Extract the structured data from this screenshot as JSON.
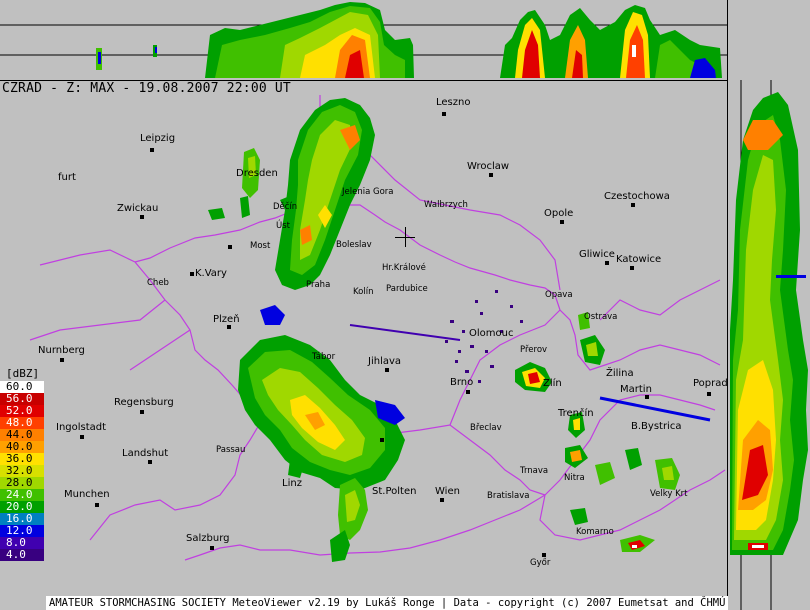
{
  "header": {
    "title": "CZRAD - Z: MAX - 19.08.2007 22:00 UT"
  },
  "legend": {
    "unit": "[dBZ]",
    "levels": [
      {
        "label": "60.0",
        "color": "#ffffff"
      },
      {
        "label": "56.0",
        "color": "#c80000"
      },
      {
        "label": "52.0",
        "color": "#e00000"
      },
      {
        "label": "48.0",
        "color": "#ff4000"
      },
      {
        "label": "44.0",
        "color": "#ff8000"
      },
      {
        "label": "40.0",
        "color": "#ffa000"
      },
      {
        "label": "36.0",
        "color": "#ffe000"
      },
      {
        "label": "32.0",
        "color": "#d8e000"
      },
      {
        "label": "28.0",
        "color": "#a0d800"
      },
      {
        "label": "24.0",
        "color": "#40c000"
      },
      {
        "label": "20.0",
        "color": "#00a000"
      },
      {
        "label": "16.0",
        "color": "#0080c0"
      },
      {
        "label": "12.0",
        "color": "#0000e0"
      },
      {
        "label": "8.0",
        "color": "#4000b0"
      },
      {
        "label": "4.0",
        "color": "#380080"
      }
    ]
  },
  "cities": [
    {
      "id": "leszno",
      "label": "Leszno"
    },
    {
      "id": "leipzig",
      "label": "Leipzig"
    },
    {
      "id": "furt",
      "label": "furt"
    },
    {
      "id": "dresden",
      "label": "Dresden"
    },
    {
      "id": "wroclaw",
      "label": "Wroclaw"
    },
    {
      "id": "czestochowa",
      "label": "Czestochowa"
    },
    {
      "id": "jelenia",
      "label": "Jelenia Gora"
    },
    {
      "id": "walbrzych",
      "label": "Walbrzych"
    },
    {
      "id": "zwickau",
      "label": "Zwickau"
    },
    {
      "id": "decin",
      "label": "Děčín"
    },
    {
      "id": "opole",
      "label": "Opole"
    },
    {
      "id": "most",
      "label": "Most"
    },
    {
      "id": "usti",
      "label": "Úst"
    },
    {
      "id": "boleslav",
      "label": "Boleslav"
    },
    {
      "id": "gliwice",
      "label": "Gliwice"
    },
    {
      "id": "katowice",
      "label": "Katowice"
    },
    {
      "id": "kvary",
      "label": "K.Vary"
    },
    {
      "id": "hkralove",
      "label": "Hr.Králové"
    },
    {
      "id": "cheb",
      "label": "Cheb"
    },
    {
      "id": "praha",
      "label": "Praha"
    },
    {
      "id": "kolin",
      "label": "Kolín"
    },
    {
      "id": "pardubice",
      "label": "Pardubice"
    },
    {
      "id": "opava",
      "label": "Opava"
    },
    {
      "id": "plzen",
      "label": "Plzeň"
    },
    {
      "id": "olomouc",
      "label": "Olomouc"
    },
    {
      "id": "ostrava",
      "label": "Ostrava"
    },
    {
      "id": "nurnberg",
      "label": "Nurnberg"
    },
    {
      "id": "tabor",
      "label": "Tábor"
    },
    {
      "id": "jihlava",
      "label": "Jihlava"
    },
    {
      "id": "prerov",
      "label": "Přerov"
    },
    {
      "id": "zilina",
      "label": "Žilina"
    },
    {
      "id": "brno",
      "label": "Brno"
    },
    {
      "id": "zlin",
      "label": "Zlín"
    },
    {
      "id": "martin",
      "label": "Martin"
    },
    {
      "id": "poprad",
      "label": "Poprad"
    },
    {
      "id": "regensburg",
      "label": "Regensburg"
    },
    {
      "id": "trencin",
      "label": "Trenčín"
    },
    {
      "id": "ingolstadt",
      "label": "Ingolstadt"
    },
    {
      "id": "breclav",
      "label": "Břeclav"
    },
    {
      "id": "bbystrica",
      "label": "B.Bystrica"
    },
    {
      "id": "passau",
      "label": "Passau"
    },
    {
      "id": "landshut",
      "label": "Landshut"
    },
    {
      "id": "trnava",
      "label": "Trnava"
    },
    {
      "id": "nitra",
      "label": "Nitra"
    },
    {
      "id": "linz",
      "label": "Linz"
    },
    {
      "id": "stpolten",
      "label": "St.Polten"
    },
    {
      "id": "wien",
      "label": "Wien"
    },
    {
      "id": "bratislava",
      "label": "Bratislava"
    },
    {
      "id": "munchen",
      "label": "Munchen"
    },
    {
      "id": "velkykrtis",
      "label": "Velky Krt"
    },
    {
      "id": "komarno",
      "label": "Komarno"
    },
    {
      "id": "salzburg",
      "label": "Salzburg"
    },
    {
      "id": "gyor",
      "label": "Győr"
    }
  ],
  "footer": {
    "credits": "AMATEUR STORMCHASING SOCIETY MeteoViewer v2.19 by Lukáš Ronge | Data - copyright (c) 2007 Eumetsat and ČHMÚ"
  }
}
